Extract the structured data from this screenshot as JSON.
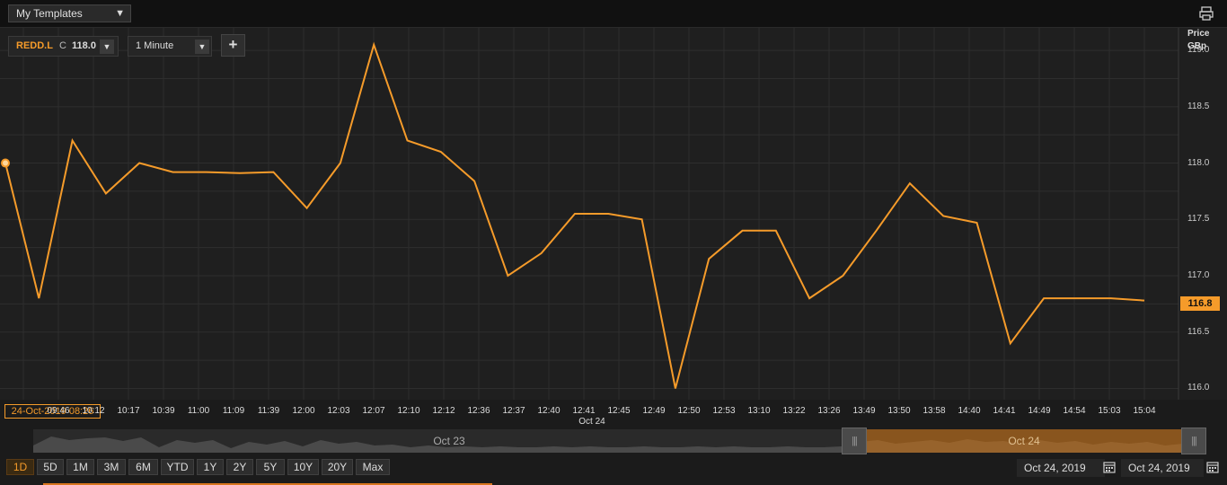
{
  "toolbar": {
    "templates_label": "My Templates",
    "dropdown_glyph": "▼",
    "print_icon": "printer-icon"
  },
  "instrument": {
    "ric": "REDD.L",
    "close_label": "C",
    "close_value": "118.0",
    "interval": "1 Minute",
    "add_glyph": "+"
  },
  "y_axis": {
    "unit_line1": "Price",
    "unit_line2": "GBp",
    "ticks": [
      "119.0",
      "118.5",
      "118.0",
      "117.5",
      "117.0",
      "116.5",
      "116.0"
    ],
    "last_value": "116.8"
  },
  "x_axis": {
    "cursor_date": "24-Oct-2019 08:26",
    "day_label": "Oct 24"
  },
  "navigator": {
    "left_label": "Oct 23",
    "right_label": "Oct 24",
    "handle_glyph": "|||"
  },
  "ranges": [
    {
      "label": "1D",
      "active": true
    },
    {
      "label": "5D",
      "active": false
    },
    {
      "label": "1M",
      "active": false
    },
    {
      "label": "3M",
      "active": false
    },
    {
      "label": "6M",
      "active": false
    },
    {
      "label": "YTD",
      "active": false
    },
    {
      "label": "1Y",
      "active": false
    },
    {
      "label": "2Y",
      "active": false
    },
    {
      "label": "5Y",
      "active": false
    },
    {
      "label": "10Y",
      "active": false
    },
    {
      "label": "20Y",
      "active": false
    },
    {
      "label": "Max",
      "active": false
    }
  ],
  "date_range": {
    "from": "Oct 24, 2019",
    "to": "Oct 24, 2019",
    "calendar_icon": "calendar-icon"
  },
  "colors": {
    "line": "#f59b2a",
    "accent": "#f59b2a",
    "background": "#1f1f1f"
  },
  "chart_data": {
    "type": "line",
    "x": [
      "08:26",
      "09:46",
      "10:12",
      "10:17",
      "10:39",
      "11:00",
      "11:09",
      "11:39",
      "12:00",
      "12:03",
      "12:07",
      "12:10",
      "12:12",
      "12:36",
      "12:37",
      "12:40",
      "12:41",
      "12:45",
      "12:49",
      "12:50",
      "12:53",
      "13:10",
      "13:22",
      "13:26",
      "13:49",
      "13:50",
      "13:58",
      "14:40",
      "14:41",
      "14:49",
      "14:54",
      "15:03",
      "15:04"
    ],
    "series": [
      {
        "values": [
          118.0,
          116.8,
          118.2,
          117.73,
          118.0,
          117.92,
          117.92,
          117.91,
          117.92,
          117.6,
          118.0,
          119.05,
          118.2,
          118.1,
          117.84,
          117.0,
          117.2,
          117.55,
          117.55,
          117.5,
          116.0,
          117.15,
          117.4,
          117.4,
          116.8,
          117.0,
          117.4,
          117.82,
          117.53,
          117.47,
          116.4,
          116.8,
          116.8,
          116.8,
          116.78
        ]
      }
    ],
    "ylim": [
      115.9,
      119.2
    ],
    "grid": true,
    "highlight_first_point": true
  }
}
